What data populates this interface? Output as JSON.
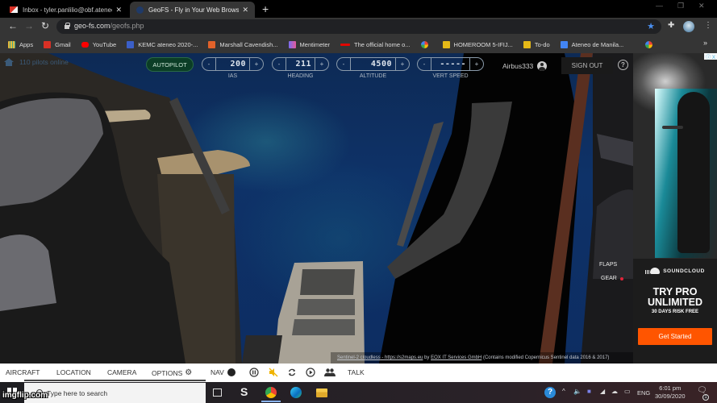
{
  "browser": {
    "tabs": [
      {
        "title": "Inbox - tyler.panlilio@obf.ateneo",
        "icon": "gmail-icon",
        "active": false
      },
      {
        "title": "GeoFS - Fly in Your Web Browser",
        "icon": "geofs-icon",
        "active": true
      }
    ],
    "new_tab": "+",
    "url_domain": "geo-fs.com",
    "url_path": "/geofs.php",
    "bookmarks": [
      {
        "label": "Apps",
        "icon": "apps-grid-icon",
        "color": "#e8b83a"
      },
      {
        "label": "Gmail",
        "icon": "gmail-icon",
        "color": "#d93025"
      },
      {
        "label": "YouTube",
        "icon": "youtube-icon",
        "color": "#ff0000"
      },
      {
        "label": "KEMC ateneo 2020-...",
        "icon": "classroom-icon",
        "color": "#3b5fc8"
      },
      {
        "label": "Marshall Cavendish...",
        "icon": "mc-icon",
        "color": "#e2622a"
      },
      {
        "label": "Mentimeter",
        "icon": "mentimeter-icon",
        "color": "#c94fd0"
      },
      {
        "label": "The official home o...",
        "icon": "f1-icon",
        "color": "#e10600"
      },
      {
        "label": "",
        "icon": "google-icon",
        "color": "#4285f4"
      },
      {
        "label": "HOMEROOM 5-IFIJ...",
        "icon": "classroom-icon",
        "color": "#e6b917"
      },
      {
        "label": "To-do",
        "icon": "classroom-icon",
        "color": "#e6b917"
      },
      {
        "label": "Ateneo de Manila...",
        "icon": "calendar-icon",
        "color": "#4285f4"
      },
      {
        "label": "",
        "icon": "google-icon",
        "color": "#4285f4"
      }
    ],
    "more_bookmarks": "»"
  },
  "hud": {
    "pilots_online": "110 pilots online",
    "autopilot_label": "AUTOPILOT",
    "controls": [
      {
        "label": "IAS",
        "value": "200",
        "minus": "-",
        "plus": "+"
      },
      {
        "label": "HEADING",
        "value": "211",
        "minus": "-",
        "plus": "+"
      },
      {
        "label": "ALTITUDE",
        "value": "4500",
        "minus": "-",
        "plus": "+"
      },
      {
        "label": "VERT SPEED",
        "value": "-----",
        "minus": "-",
        "plus": "+"
      }
    ],
    "username": "Airbus333",
    "sign_out": "SIGN OUT",
    "help": "?",
    "flaps_label": "FLAPS",
    "gear_label": "GEAR",
    "gear_status_color": "#e0243a",
    "attribution_link1": "Sentinel-2 cloudless - https://s2maps.eu",
    "attribution_by": " by ",
    "attribution_link2": "EOX IT Services GmbH",
    "attribution_tail": " (Contains modified Copernicus Sentinel data 2016 & 2017)"
  },
  "ad": {
    "brand": "SOUNDCLOUD",
    "headline_1": "TRY PRO",
    "headline_2": "UNLIMITED",
    "subline": "30 DAYS RISK FREE",
    "cta": "Get Started",
    "cta_color": "#ff5500",
    "adchoices": "ⓘ X"
  },
  "bottom_menu": {
    "items": [
      "AIRCRAFT",
      "LOCATION",
      "CAMERA",
      "OPTIONS",
      "NAV",
      "TALK"
    ]
  },
  "taskbar": {
    "search_placeholder": "Type here to search",
    "watermark": "imgflip.com",
    "language": "ENG",
    "time": "6:01 pm",
    "date": "30/09/2020",
    "notification_count": "1"
  }
}
